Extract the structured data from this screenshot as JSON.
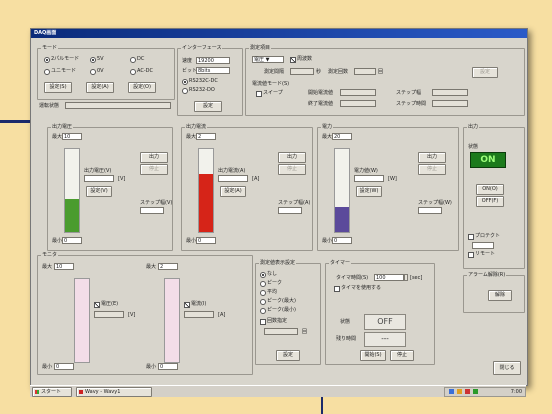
{
  "window": {
    "title": "DAQ画面"
  },
  "mode": {
    "group": "モード",
    "radios": [
      {
        "label": "2パルモード",
        "selected": true
      },
      {
        "label": "5V",
        "selected": true
      },
      {
        "label": "DC",
        "selected": false
      },
      {
        "label": "ユニモード",
        "selected": false
      },
      {
        "label": "0V",
        "selected": false
      },
      {
        "label": "AC-DC",
        "selected": false
      }
    ],
    "buttons": [
      "設定(S)",
      "設定(A)",
      "設定(O)"
    ],
    "status_label": "運転状態",
    "status_value": ""
  },
  "interface": {
    "group": "インターフェース",
    "speed_label": "速度",
    "speed_value": "19200",
    "data_label": "ビット",
    "data_value": "8bits",
    "radios": [
      {
        "label": "RS232C-DC",
        "selected": true
      },
      {
        "label": "RS232-DO",
        "selected": false
      }
    ],
    "button": "設定"
  },
  "measure": {
    "group": "測定項目",
    "select_value": "電圧 ▼",
    "checkbox": "周波数",
    "fields": [
      "測定間隔",
      "測定回数",
      "秒",
      "回"
    ],
    "button": "設定",
    "sub_group": "電流値モード(S)",
    "sub_items": [
      "スイープ",
      "開始電流値",
      "終了電流値",
      "ステップ幅",
      "ステップ時間"
    ]
  },
  "ch_v": {
    "group": "出力電圧",
    "max_label": "最大",
    "max_value": "10",
    "min_label": "最小",
    "min_value": "0",
    "set_label": "出力電圧(V)",
    "unit": "[V]",
    "buttons": [
      "設定(V)",
      "出力",
      "停止"
    ],
    "sweep_label": "ステップ幅(V)",
    "level": 0.4,
    "color": "#4a9c2e"
  },
  "ch_a": {
    "group": "出力電流",
    "max_label": "最大",
    "max_value": "2",
    "min_label": "最小",
    "min_value": "0",
    "set_label": "出力電流(A)",
    "unit": "[A]",
    "buttons": [
      "設定(A)",
      "出力",
      "停止"
    ],
    "sweep_label": "ステップ幅(A)",
    "level": 0.7,
    "color": "#d62418"
  },
  "ch_w": {
    "group": "電力",
    "max_label": "最大",
    "max_value": "20",
    "min_label": "最小",
    "min_value": "0",
    "set_label": "電力値(W)",
    "unit": "[W]",
    "buttons": [
      "設定(W)",
      "出力",
      "停止"
    ],
    "sweep_label": "ステップ幅(W)",
    "level": 0.3,
    "color": "#5b4a9b"
  },
  "output": {
    "group": "出力",
    "state_label": "状態",
    "state_value": "ON",
    "buttons": [
      "ON(O)",
      "OFF(F)"
    ],
    "checks": [
      "プロテクト",
      "リモート"
    ],
    "alarm_group": "アラーム解除(R)",
    "alarm_button": "解除"
  },
  "monitor": {
    "group": "モニタ",
    "left": {
      "max_label": "最大",
      "max_value": "10",
      "min_label": "最小",
      "min_value": "0",
      "check": "電圧(E)",
      "unit": "[V]"
    },
    "right": {
      "max_label": "最大",
      "max_value": "2",
      "min_label": "最小",
      "min_value": "0",
      "check": "電流(I)",
      "unit": "[A]"
    }
  },
  "trigger": {
    "group": "測定値表示設定",
    "radios": [
      {
        "label": "なし",
        "selected": true
      },
      {
        "label": "ピーク",
        "selected": false
      },
      {
        "label": "平均",
        "selected": false
      },
      {
        "label": "ピーク(最大)",
        "selected": false
      },
      {
        "label": "ピーク(最小)",
        "selected": false
      }
    ],
    "check": "回数指定",
    "unit": "回",
    "button": "設定"
  },
  "timer": {
    "group": "タイマー",
    "field_label": "タイマ時間(S)",
    "field_value": "100",
    "unit": "[sec]",
    "check": "タイマを使用する",
    "state_label": "状態",
    "state_value": "OFF",
    "remain_label": "残り時間",
    "remain_value": "---",
    "buttons": [
      "開始(S)",
      "停止"
    ]
  },
  "close_button": "閉じる",
  "taskbar": {
    "start": "スタート",
    "task": "Wavy - Wavy1",
    "clock": "7:00"
  }
}
